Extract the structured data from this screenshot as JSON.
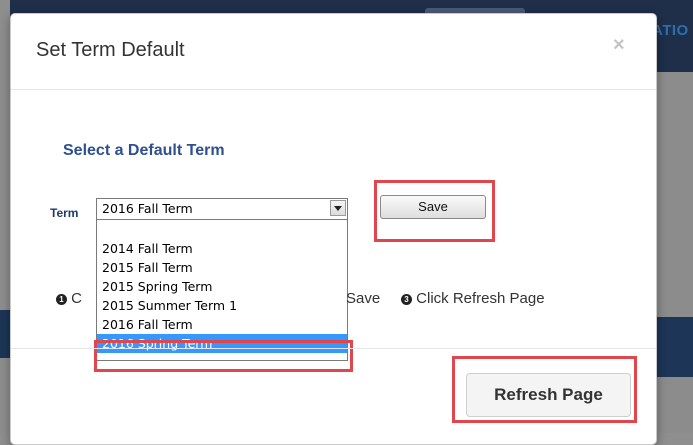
{
  "background": {
    "nav_text": "ATIO"
  },
  "modal": {
    "title": "Set Term Default",
    "close_icon": "×",
    "section_heading": "Select a Default Term",
    "term_label": "Term",
    "selected_value": "2016 Fall Term",
    "options": [
      "",
      "2014 Fall Term",
      "2015 Fall Term",
      "2015 Spring Term",
      "2015 Summer Term 1",
      "2016 Fall Term",
      "2016 Spring Term"
    ],
    "highlighted_option": "2016 Spring Term",
    "save_label": "Save",
    "steps": {
      "step1_num": "1",
      "step1_text": "C",
      "step2_tail_text": "Save",
      "step3_num": "3",
      "step3_text": "Click Refresh Page"
    },
    "refresh_label": "Refresh Page"
  },
  "colors": {
    "heading": "#2f4f8f",
    "highlight_box": "#e0474c",
    "selected_option_bg": "#3399ff"
  }
}
